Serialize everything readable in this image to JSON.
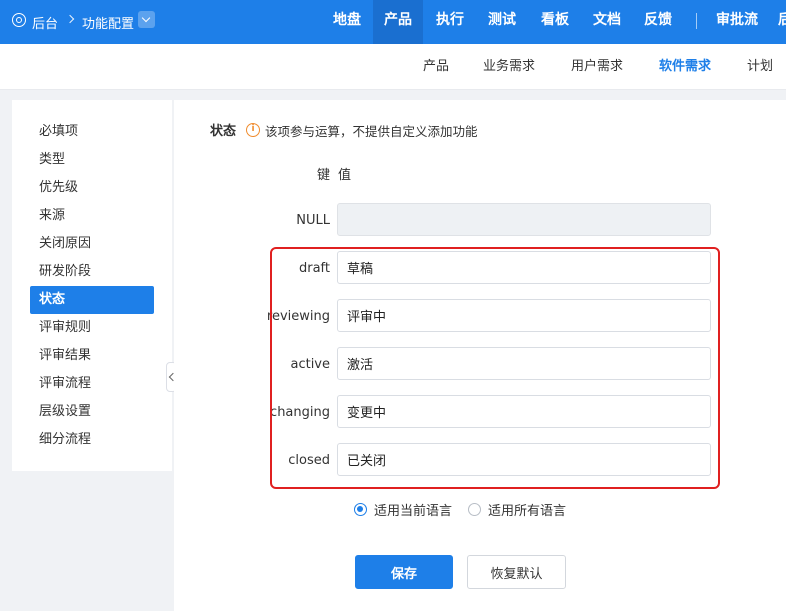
{
  "header": {
    "breadcrumb": {
      "root": "后台",
      "current": "功能配置"
    },
    "nav": [
      "地盘",
      "产品",
      "执行",
      "测试",
      "看板",
      "文档",
      "反馈",
      "审批流",
      "后"
    ],
    "active_nav": "产品"
  },
  "subnav": {
    "items": [
      "产品",
      "业务需求",
      "用户需求",
      "软件需求",
      "计划"
    ],
    "active": "软件需求"
  },
  "sidebar": {
    "items": [
      "必填项",
      "类型",
      "优先级",
      "来源",
      "关闭原因",
      "研发阶段",
      "状态",
      "评审规则",
      "评审结果",
      "评审流程",
      "层级设置",
      "细分流程"
    ],
    "active": "状态"
  },
  "form": {
    "title": "状态",
    "notice": "该项参与运算，不提供自定义添加功能",
    "col_key": "键",
    "col_value": "值",
    "rows": [
      {
        "key": "NULL",
        "value": ""
      },
      {
        "key": "draft",
        "value": "草稿"
      },
      {
        "key": "reviewing",
        "value": "评审中"
      },
      {
        "key": "active",
        "value": "激活"
      },
      {
        "key": "changing",
        "value": "变更中"
      },
      {
        "key": "closed",
        "value": "已关闭"
      }
    ],
    "lang_options": [
      "适用当前语言",
      "适用所有语言"
    ],
    "lang_selected": "适用当前语言",
    "save_label": "保存",
    "reset_label": "恢复默认"
  },
  "colors": {
    "accent": "#1e7fe8",
    "highlight": "#e02020",
    "warning": "#f08c2e"
  }
}
